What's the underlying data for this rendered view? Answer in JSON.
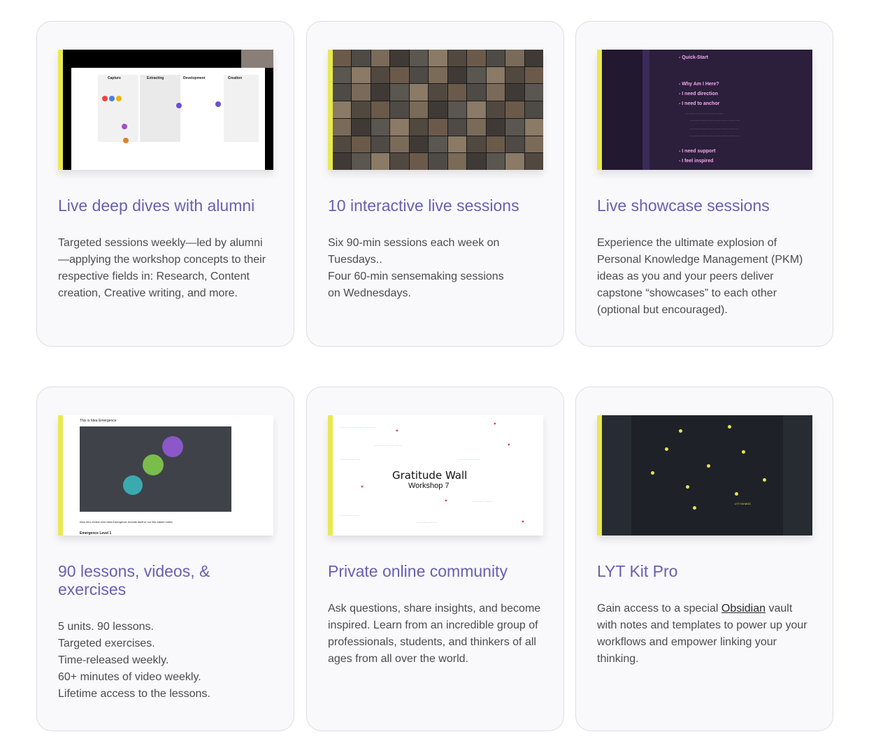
{
  "cards": [
    {
      "title": "Live deep dives with alumni",
      "body_lines": [
        "Targeted sessions weekly—led by alumni",
        "—applying the workshop concepts to their",
        "respective fields in: Research, Content",
        "creation, Creative writing, and more."
      ],
      "thumb": {
        "labels": [
          "Capture",
          "Extracting",
          "Development",
          "Creation"
        ]
      }
    },
    {
      "title": "10 interactive live sessions",
      "body_lines": [
        "Six 90-min sessions each week on",
        "Tuesdays..",
        "Four 60-min sensemaking sessions",
        "on Wednesdays."
      ]
    },
    {
      "title": "Live showcase sessions",
      "body_lines": [
        "Experience the ultimate explosion of",
        "Personal Knowledge Management (PKM)",
        "ideas as you and your peers deliver",
        "capstone “showcases” to each other",
        "(optional but encouraged)."
      ],
      "thumb": {
        "lines": [
          "- Quick-Start",
          "- Why Am I Here?",
          "- I need direction",
          "- I need to anchor",
          "- I need support",
          "- I feel inspired"
        ]
      }
    },
    {
      "title": "90 lessons, videos, & exercises",
      "body_lines": [
        "5 units. 90 lessons.",
        "Targeted exercises.",
        "Time-released weekly.",
        "60+ minutes of video weekly.",
        "Lifetime access to the lessons."
      ],
      "thumb": {
        "header": "This is Idea Emergence",
        "caption": "Now let's review how Idea Emergence reveals itself in our link-based notes:",
        "footer": "Emergence Level 1"
      }
    },
    {
      "title": "Private online community",
      "body_lines": [
        "Ask questions, share insights, and become",
        "inspired. Learn from an incredible group of",
        "professionals, students, and thinkers of all",
        "ages from all over the world."
      ],
      "thumb": {
        "title": "Gratitude Wall",
        "subtitle": "Workshop 7"
      }
    },
    {
      "title": "LYT Kit Pro",
      "body_before_link": "Gain access to a special ",
      "link_text": "Obsidian",
      "body_after_link": " vault",
      "body_lines": [
        "with notes and templates to power up your",
        "workflows and empower linking your",
        "thinking."
      ],
      "thumb": {
        "label": "LYT Kit MOC"
      }
    }
  ],
  "colors": {
    "accent_title": "#6a5fb0",
    "highlight_bar": "#e9e951",
    "card_border": "#dcdce4"
  }
}
